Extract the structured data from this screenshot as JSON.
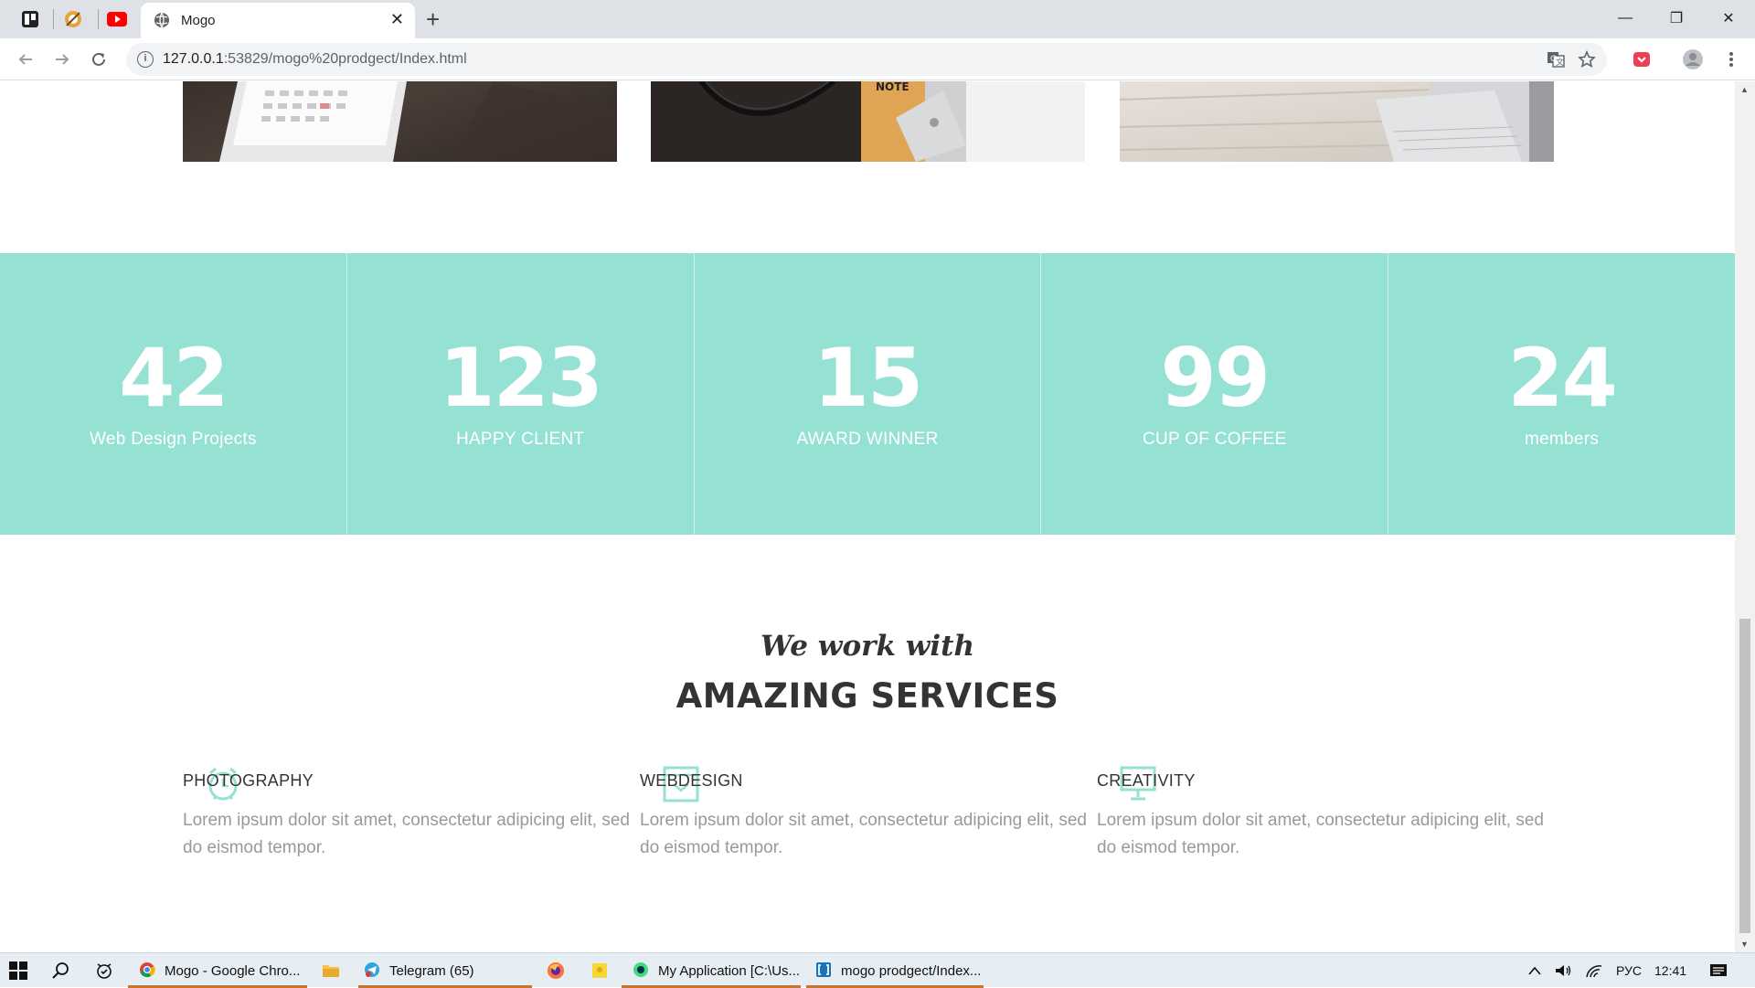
{
  "browser": {
    "tab_title": "Mogo",
    "url_host": "127.0.0.1",
    "url_rest": ":53829/mogo%20prodgect/Index.html",
    "controls": {
      "minimize": "—",
      "maximize": "❐",
      "close": "✕",
      "new_tab": "+",
      "tab_close": "✕"
    }
  },
  "stats": [
    {
      "number": "42",
      "label": "Web Design Projects"
    },
    {
      "number": "123",
      "label": "HAPPY CLIENT"
    },
    {
      "number": "15",
      "label": "AWARD WINNER"
    },
    {
      "number": "99",
      "label": "CUP OF COFFEE"
    },
    {
      "number": "24",
      "label": "members"
    }
  ],
  "services_section": {
    "subtitle": "We work with",
    "title": "AMAZING SERVICES",
    "items": [
      {
        "title": "PHOTOGRAPHY",
        "text": "Lorem ipsum dolor sit amet, consectetur adipicing elit, sed do eismod tempor.",
        "icon": "alarm-clock-icon"
      },
      {
        "title": "WEBDESIGN",
        "text": "Lorem ipsum dolor sit amet, consectetur adipicing elit, sed do eismod tempor.",
        "icon": "book-icon"
      },
      {
        "title": "CREATIVITY",
        "text": "Lorem ipsum dolor sit amet, consectetur adipicing elit, sed do eismod tempor.",
        "icon": "monitor-icon"
      }
    ]
  },
  "colors": {
    "accent": "#95e1d3",
    "heading": "#333333",
    "body_text": "#999999"
  },
  "taskbar": {
    "items": [
      {
        "label": "Mogo - Google Chro..."
      },
      {
        "label": "Telegram (65)"
      },
      {
        "label": "My Application [C:\\Us..."
      },
      {
        "label": "mogo prodgect/Index..."
      }
    ],
    "language": "РУС",
    "time": "12:41"
  }
}
